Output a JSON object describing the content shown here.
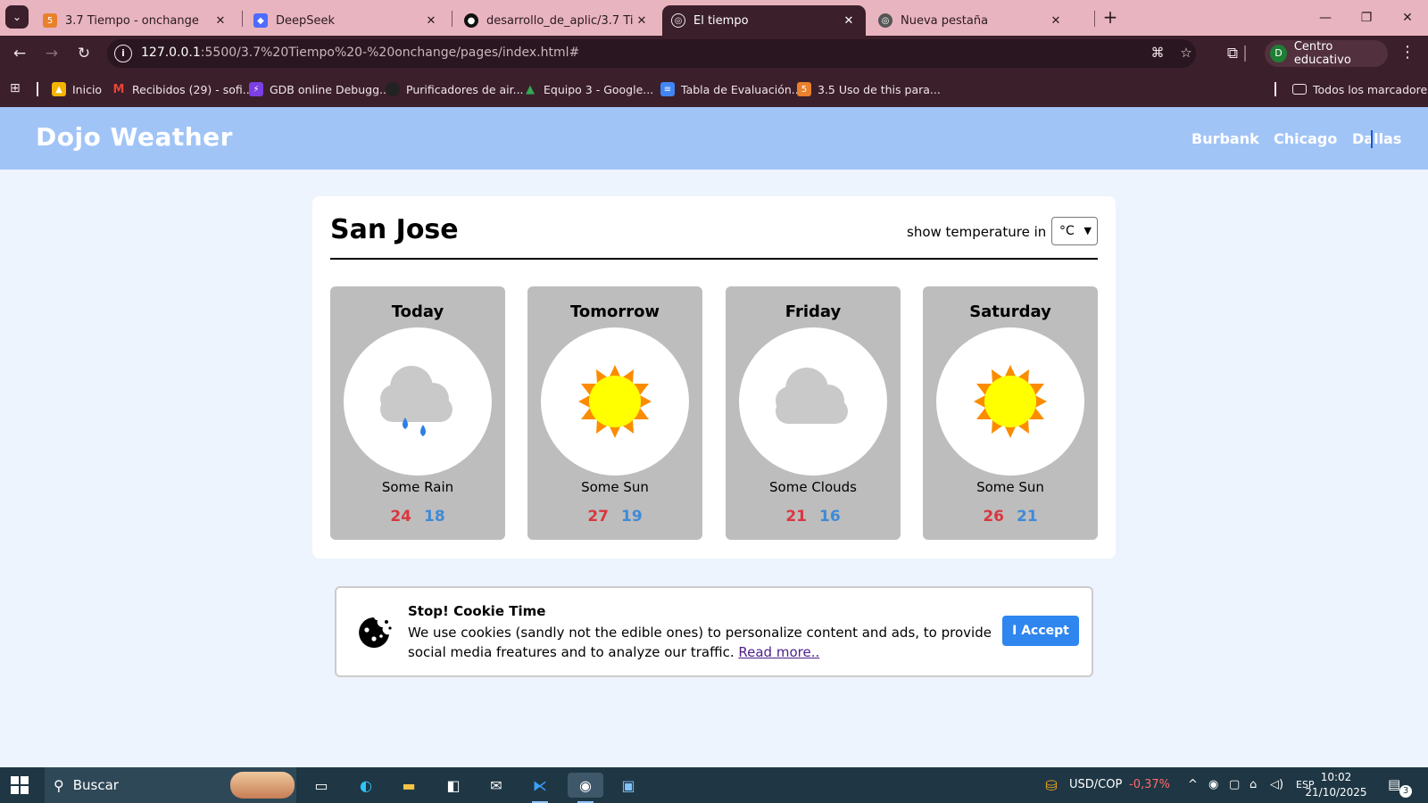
{
  "browser": {
    "tabs": [
      {
        "title": "3.7 Tiempo - onchange",
        "icon": "html-file-icon",
        "color": "#e8802c",
        "active": false
      },
      {
        "title": "DeepSeek",
        "icon": "deepseek-icon",
        "color": "#4d6bfe",
        "active": false
      },
      {
        "title": "desarrollo_de_aplic/3.7 Tiempo",
        "icon": "github-icon",
        "color": "#111111",
        "active": false
      },
      {
        "title": "El tiempo",
        "icon": "globe-icon",
        "color": "#f2e6ea",
        "active": true
      },
      {
        "title": "Nueva pestaña",
        "icon": "chrome-icon",
        "color": "#555555",
        "active": false
      }
    ],
    "url_host": "127.0.0.1",
    "url_rest": ":5500/3.7%20Tiempo%20-%20onchange/pages/index.html#",
    "profile_initial": "D",
    "profile_name": "Centro educativo",
    "bookmarks": [
      {
        "label": "Inicio",
        "icon": "html-file-icon",
        "color": "#f4b400"
      },
      {
        "label": "Recibidos (29) - sofi...",
        "icon": "gmail-icon",
        "color": "#ea4335"
      },
      {
        "label": "GDB online Debugg...",
        "icon": "bolt-icon",
        "color": "#7b3fe4"
      },
      {
        "label": "Purificadores de air...",
        "icon": "circle-logo-icon",
        "color": "#222222"
      },
      {
        "label": "Equipo 3 - Google...",
        "icon": "drive-icon",
        "color": "#34a853"
      },
      {
        "label": "Tabla de Evaluación...",
        "icon": "docs-icon",
        "color": "#4285f4"
      },
      {
        "label": "3.5 Uso de this para...",
        "icon": "html-file-icon",
        "color": "#e8802c"
      }
    ],
    "all_bookmarks": "Todos los marcadores"
  },
  "site": {
    "logo": "Dojo Weather",
    "nav": [
      "Burbank",
      "Chicago",
      "Dallas"
    ],
    "header_color": "#a1c4f7"
  },
  "weather": {
    "city": "San Jose",
    "temp_label": "show temperature in",
    "unit": "°C",
    "days": [
      {
        "name": "Today",
        "condition": "rain-cloud-icon",
        "desc": "Some Rain",
        "high": "24",
        "low": "18"
      },
      {
        "name": "Tomorrow",
        "condition": "sun-icon",
        "desc": "Some Sun",
        "high": "27",
        "low": "19"
      },
      {
        "name": "Friday",
        "condition": "cloud-icon",
        "desc": "Some Clouds",
        "high": "21",
        "low": "16"
      },
      {
        "name": "Saturday",
        "condition": "sun-icon",
        "desc": "Some Sun",
        "high": "26",
        "low": "21"
      }
    ],
    "high_color": "#d9373f",
    "low_color": "#3f8ad8"
  },
  "cookie": {
    "title": "Stop! Cookie Time",
    "text": "We use cookies (sandly not the edible ones) to personalize content and ads, to provide social media freatures and to analyze our traffic. ",
    "link": "Read more..",
    "button": "I Accept"
  },
  "taskbar": {
    "search": "Buscar",
    "ticker": "USD/COP",
    "ticker_change": "-0,37%",
    "lang": "ESP",
    "time": "10:02",
    "date": "21/10/2025",
    "notifications": "3"
  }
}
